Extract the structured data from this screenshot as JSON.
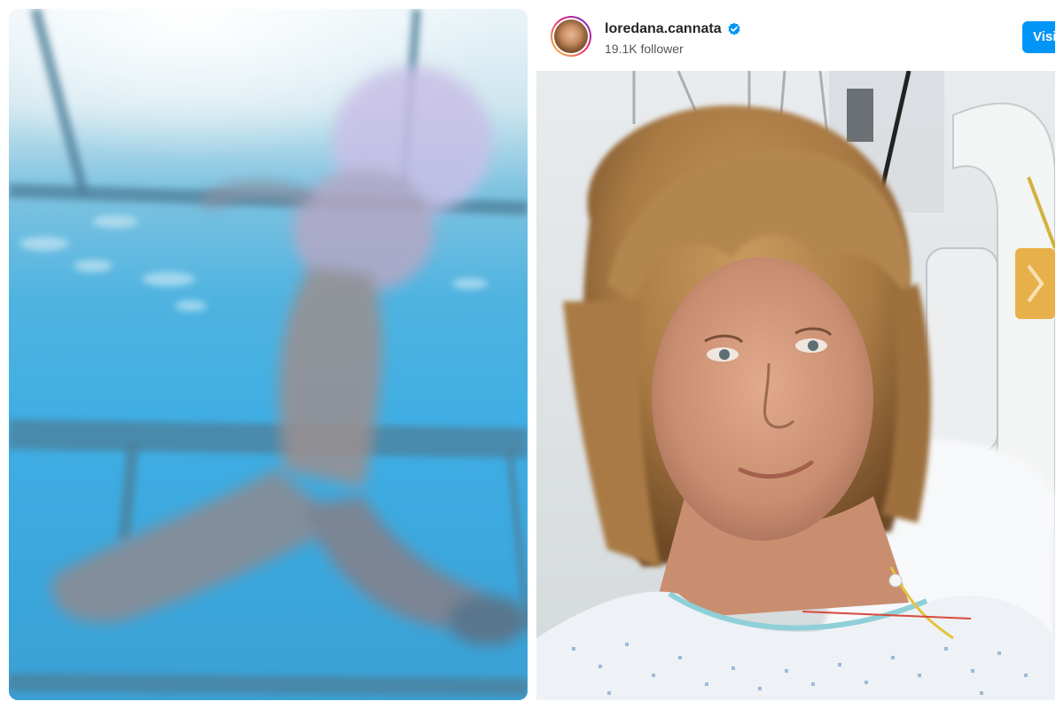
{
  "post": {
    "username": "loredana.cannata",
    "followers": "19.1K follower",
    "visit_label": "Visit",
    "verified_icon": "verified-badge-icon",
    "accent_color": "#0095f6"
  },
  "left_image": {
    "kind": "photo",
    "scene": "underwater-cage"
  },
  "right_image": {
    "kind": "photo",
    "scene": "hospital-selfie"
  }
}
